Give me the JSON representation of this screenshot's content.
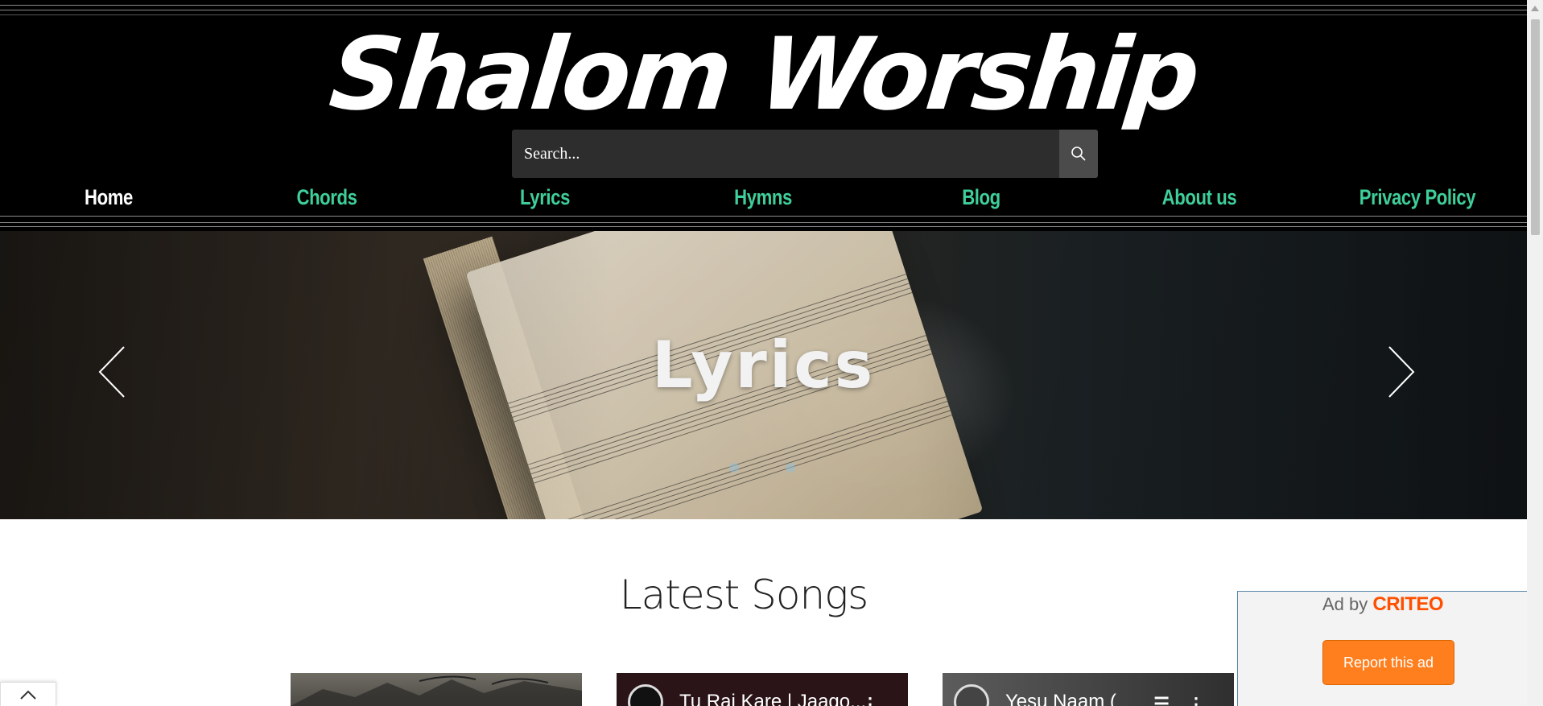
{
  "site": {
    "logo_text": "Shalom Worship"
  },
  "search": {
    "placeholder": "Search...",
    "icon": "search-icon"
  },
  "nav": {
    "items": [
      {
        "label": "Home",
        "active": true
      },
      {
        "label": "Chords",
        "active": false
      },
      {
        "label": "Lyrics",
        "active": false
      },
      {
        "label": "Hymns",
        "active": false
      },
      {
        "label": "Blog",
        "active": false
      },
      {
        "label": "About us",
        "active": false
      },
      {
        "label": "Privacy Policy",
        "active": false
      }
    ],
    "active_color": "#ffffff",
    "link_color": "#3fcf9a"
  },
  "hero": {
    "title": "Lyrics",
    "prev_icon": "chevron-left-icon",
    "next_icon": "chevron-right-icon",
    "slide_count": 2
  },
  "content": {
    "section_title": "Latest Songs",
    "cards": [
      {
        "title": ""
      },
      {
        "title": "Tu Raj Kare | Jaago..."
      },
      {
        "title": "Yesu Naam ("
      }
    ]
  },
  "ad": {
    "label": "Ad by",
    "brand": "CRITEO",
    "report_label": "Report this ad",
    "brand_color": "#fe5000",
    "button_color": "#ff7f1e"
  },
  "back_to_top_icon": "chevron-up-icon"
}
